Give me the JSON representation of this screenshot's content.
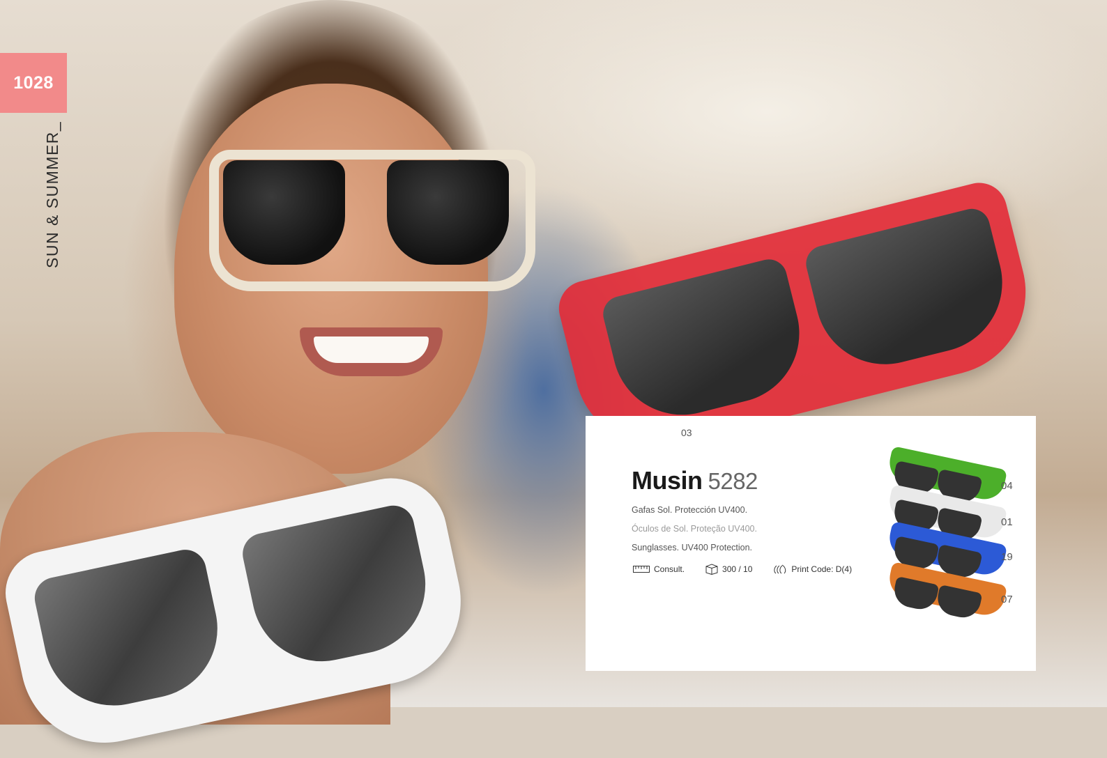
{
  "page": {
    "number": "1028",
    "section": "SUN & SUMMER_"
  },
  "hero": {
    "variant_code": "03"
  },
  "product": {
    "name": "Musin",
    "reference": "5282",
    "descriptions": {
      "es": "Gafas Sol. Protección UV400.",
      "pt": "Óculos de Sol. Proteção UV400.",
      "en": "Sunglasses. UV400 Protection."
    },
    "specs": [
      {
        "icon": "ruler-icon",
        "text": "Consult."
      },
      {
        "icon": "box-icon",
        "text": "300 / 10"
      },
      {
        "icon": "print-icon",
        "text": "Print Code: D(4)"
      }
    ],
    "variants": [
      {
        "code": "04",
        "color": "#4caf2a"
      },
      {
        "code": "01",
        "color": "#e9e9e9"
      },
      {
        "code": "19",
        "color": "#2c5ad6"
      },
      {
        "code": "07",
        "color": "#e07a2a"
      }
    ]
  },
  "colors": {
    "accent": "#f28a8a",
    "red_frame": "#e22c38"
  }
}
